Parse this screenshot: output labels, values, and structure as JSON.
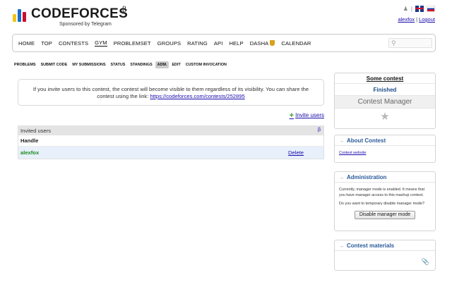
{
  "header": {
    "logo_text": "CODEFORCES",
    "logo_beta": "β",
    "logo_sponsor": "Sponsored by Telegram",
    "user": "alexfox",
    "logout": "Logout",
    "separator": "|",
    "lang_uk": "flag-uk-icon",
    "lang_ru": "flag-ru-icon"
  },
  "nav": {
    "items": [
      "HOME",
      "TOP",
      "CONTESTS",
      "GYM",
      "PROBLEMSET",
      "GROUPS",
      "RATING",
      "API",
      "HELP",
      "DASHA",
      "CALENDAR"
    ],
    "active": "GYM"
  },
  "subnav": {
    "items": [
      "PROBLEMS",
      "SUBMIT CODE",
      "MY SUBMISSIONS",
      "STATUS",
      "STANDINGS",
      "ADM.",
      "EDIT",
      "CUSTOM INVOCATION"
    ],
    "active": "ADM."
  },
  "notice": {
    "text": "If you invite users to this contest, the contest will become visible to them regardless of its visibility. You can share the contest using the link:",
    "link": "https://codeforces.com/contests/252895"
  },
  "invite_users": "Invite users",
  "table": {
    "caption": "Invited users",
    "header": "Handle",
    "rows": [
      {
        "handle": "alexfox",
        "action": "Delete"
      }
    ]
  },
  "sidebar": {
    "contest_name": "Some contest",
    "status": "Finished",
    "role": "Contest Manager",
    "about_title": "About Contest",
    "about_link": "Contest website",
    "admin_title": "Administration",
    "admin_text1": "Currently, manager mode is enabled. It means that you have manager access to this mashup contest.",
    "admin_text2": "Do you want to temporary disable manager mode?",
    "admin_button": "Disable manager mode",
    "materials_title": "Contest materials"
  },
  "colors": {
    "link": "#1a0dab",
    "user_green": "#1f8a1f",
    "row_highlight": "#e7f0fb",
    "sidebar_title": "#2a5a9a"
  }
}
